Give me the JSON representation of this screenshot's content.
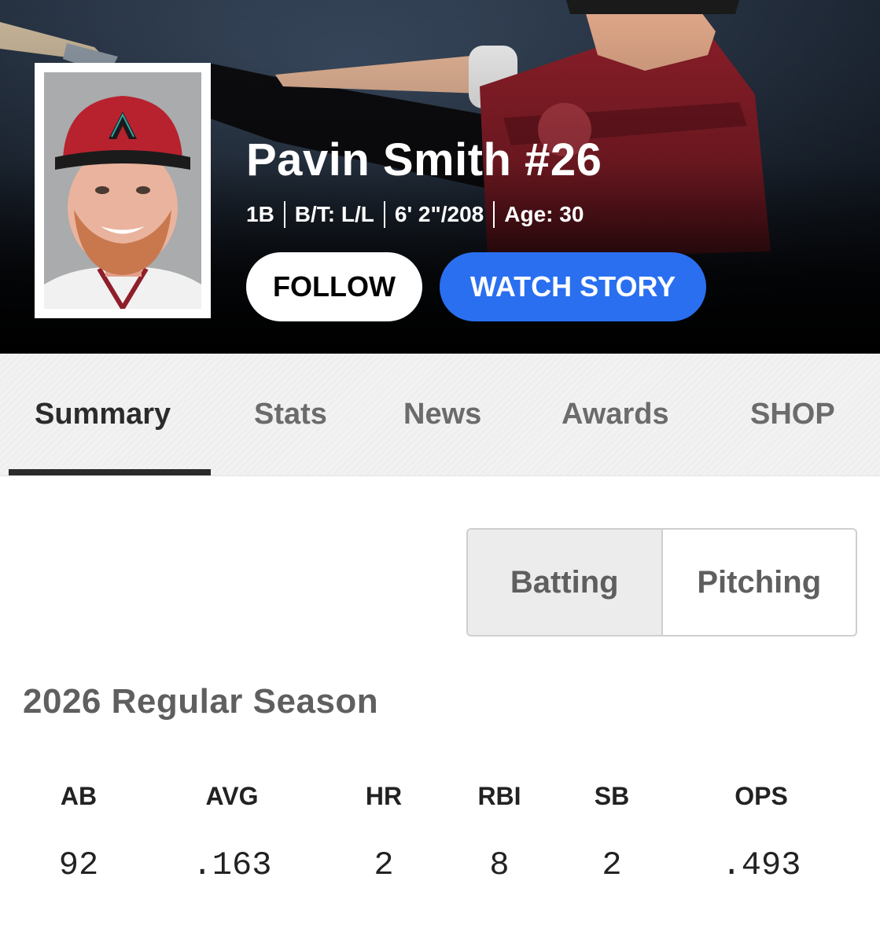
{
  "player": {
    "name": "Pavin Smith #26",
    "bio": [
      "1B",
      "B/T: L/L",
      "6' 2\"/208",
      "Age: 30"
    ]
  },
  "actions": {
    "follow_label": "FOLLOW",
    "watch_label": "WATCH STORY"
  },
  "tabs": [
    {
      "label": "Summary",
      "active": true
    },
    {
      "label": "Stats",
      "active": false
    },
    {
      "label": "News",
      "active": false
    },
    {
      "label": "Awards",
      "active": false
    },
    {
      "label": "SHOP",
      "active": false
    }
  ],
  "toggle": {
    "options": [
      "Batting",
      "Pitching"
    ],
    "selected": "Batting"
  },
  "season": {
    "title": "2026 Regular Season",
    "stats": [
      {
        "label": "AB",
        "value": "92"
      },
      {
        "label": "AVG",
        "value": ".163"
      },
      {
        "label": "HR",
        "value": "2"
      },
      {
        "label": "RBI",
        "value": "8"
      },
      {
        "label": "SB",
        "value": "2"
      },
      {
        "label": "OPS",
        "value": ".493"
      }
    ]
  },
  "colors": {
    "watch_button": "#2a6ff0",
    "jersey_red": "#8e1f2a",
    "tab_underline": "#2b2b2b"
  }
}
